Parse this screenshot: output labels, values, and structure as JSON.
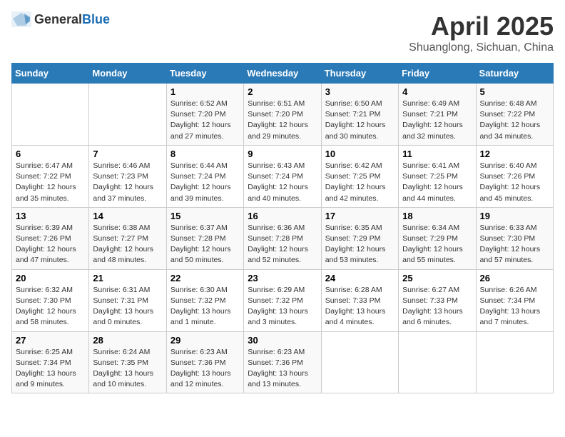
{
  "header": {
    "logo_general": "General",
    "logo_blue": "Blue",
    "title": "April 2025",
    "subtitle": "Shuanglong, Sichuan, China"
  },
  "weekdays": [
    "Sunday",
    "Monday",
    "Tuesday",
    "Wednesday",
    "Thursday",
    "Friday",
    "Saturday"
  ],
  "weeks": [
    [
      {
        "day": "",
        "info": ""
      },
      {
        "day": "",
        "info": ""
      },
      {
        "day": "1",
        "info": "Sunrise: 6:52 AM\nSunset: 7:20 PM\nDaylight: 12 hours and 27 minutes."
      },
      {
        "day": "2",
        "info": "Sunrise: 6:51 AM\nSunset: 7:20 PM\nDaylight: 12 hours and 29 minutes."
      },
      {
        "day": "3",
        "info": "Sunrise: 6:50 AM\nSunset: 7:21 PM\nDaylight: 12 hours and 30 minutes."
      },
      {
        "day": "4",
        "info": "Sunrise: 6:49 AM\nSunset: 7:21 PM\nDaylight: 12 hours and 32 minutes."
      },
      {
        "day": "5",
        "info": "Sunrise: 6:48 AM\nSunset: 7:22 PM\nDaylight: 12 hours and 34 minutes."
      }
    ],
    [
      {
        "day": "6",
        "info": "Sunrise: 6:47 AM\nSunset: 7:22 PM\nDaylight: 12 hours and 35 minutes."
      },
      {
        "day": "7",
        "info": "Sunrise: 6:46 AM\nSunset: 7:23 PM\nDaylight: 12 hours and 37 minutes."
      },
      {
        "day": "8",
        "info": "Sunrise: 6:44 AM\nSunset: 7:24 PM\nDaylight: 12 hours and 39 minutes."
      },
      {
        "day": "9",
        "info": "Sunrise: 6:43 AM\nSunset: 7:24 PM\nDaylight: 12 hours and 40 minutes."
      },
      {
        "day": "10",
        "info": "Sunrise: 6:42 AM\nSunset: 7:25 PM\nDaylight: 12 hours and 42 minutes."
      },
      {
        "day": "11",
        "info": "Sunrise: 6:41 AM\nSunset: 7:25 PM\nDaylight: 12 hours and 44 minutes."
      },
      {
        "day": "12",
        "info": "Sunrise: 6:40 AM\nSunset: 7:26 PM\nDaylight: 12 hours and 45 minutes."
      }
    ],
    [
      {
        "day": "13",
        "info": "Sunrise: 6:39 AM\nSunset: 7:26 PM\nDaylight: 12 hours and 47 minutes."
      },
      {
        "day": "14",
        "info": "Sunrise: 6:38 AM\nSunset: 7:27 PM\nDaylight: 12 hours and 48 minutes."
      },
      {
        "day": "15",
        "info": "Sunrise: 6:37 AM\nSunset: 7:28 PM\nDaylight: 12 hours and 50 minutes."
      },
      {
        "day": "16",
        "info": "Sunrise: 6:36 AM\nSunset: 7:28 PM\nDaylight: 12 hours and 52 minutes."
      },
      {
        "day": "17",
        "info": "Sunrise: 6:35 AM\nSunset: 7:29 PM\nDaylight: 12 hours and 53 minutes."
      },
      {
        "day": "18",
        "info": "Sunrise: 6:34 AM\nSunset: 7:29 PM\nDaylight: 12 hours and 55 minutes."
      },
      {
        "day": "19",
        "info": "Sunrise: 6:33 AM\nSunset: 7:30 PM\nDaylight: 12 hours and 57 minutes."
      }
    ],
    [
      {
        "day": "20",
        "info": "Sunrise: 6:32 AM\nSunset: 7:30 PM\nDaylight: 12 hours and 58 minutes."
      },
      {
        "day": "21",
        "info": "Sunrise: 6:31 AM\nSunset: 7:31 PM\nDaylight: 13 hours and 0 minutes."
      },
      {
        "day": "22",
        "info": "Sunrise: 6:30 AM\nSunset: 7:32 PM\nDaylight: 13 hours and 1 minute."
      },
      {
        "day": "23",
        "info": "Sunrise: 6:29 AM\nSunset: 7:32 PM\nDaylight: 13 hours and 3 minutes."
      },
      {
        "day": "24",
        "info": "Sunrise: 6:28 AM\nSunset: 7:33 PM\nDaylight: 13 hours and 4 minutes."
      },
      {
        "day": "25",
        "info": "Sunrise: 6:27 AM\nSunset: 7:33 PM\nDaylight: 13 hours and 6 minutes."
      },
      {
        "day": "26",
        "info": "Sunrise: 6:26 AM\nSunset: 7:34 PM\nDaylight: 13 hours and 7 minutes."
      }
    ],
    [
      {
        "day": "27",
        "info": "Sunrise: 6:25 AM\nSunset: 7:34 PM\nDaylight: 13 hours and 9 minutes."
      },
      {
        "day": "28",
        "info": "Sunrise: 6:24 AM\nSunset: 7:35 PM\nDaylight: 13 hours and 10 minutes."
      },
      {
        "day": "29",
        "info": "Sunrise: 6:23 AM\nSunset: 7:36 PM\nDaylight: 13 hours and 12 minutes."
      },
      {
        "day": "30",
        "info": "Sunrise: 6:23 AM\nSunset: 7:36 PM\nDaylight: 13 hours and 13 minutes."
      },
      {
        "day": "",
        "info": ""
      },
      {
        "day": "",
        "info": ""
      },
      {
        "day": "",
        "info": ""
      }
    ]
  ]
}
